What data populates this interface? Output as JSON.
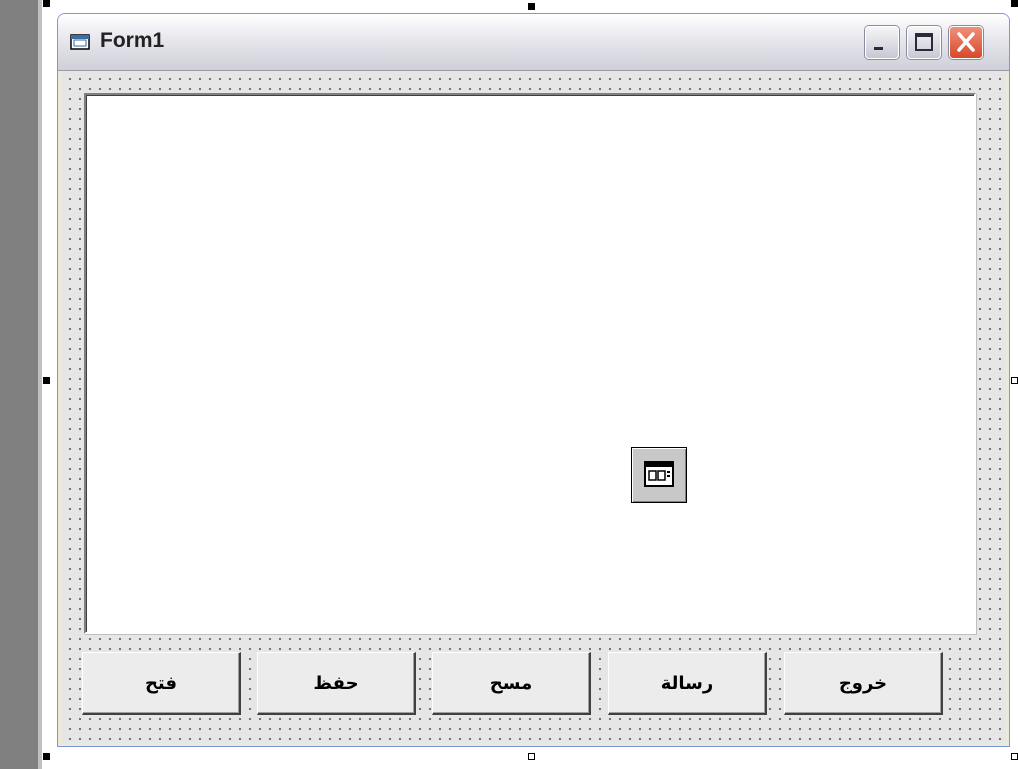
{
  "window": {
    "title": "Form1",
    "controls": {
      "minimize_icon": "minimize-icon",
      "maximize_icon": "maximize-icon",
      "close_icon": "close-icon"
    }
  },
  "form": {
    "textbox_value": "",
    "component_icon": "component-icon",
    "buttons": [
      {
        "label": "فتح"
      },
      {
        "label": "حفظ"
      },
      {
        "label": "مسح"
      },
      {
        "label": "رسالة"
      },
      {
        "label": "خروج"
      }
    ]
  },
  "colors": {
    "close_button": "#d6492a",
    "title_bar": "#e9e9ef",
    "client_area": "#e6e6e6",
    "textbox": "#ffffff"
  }
}
